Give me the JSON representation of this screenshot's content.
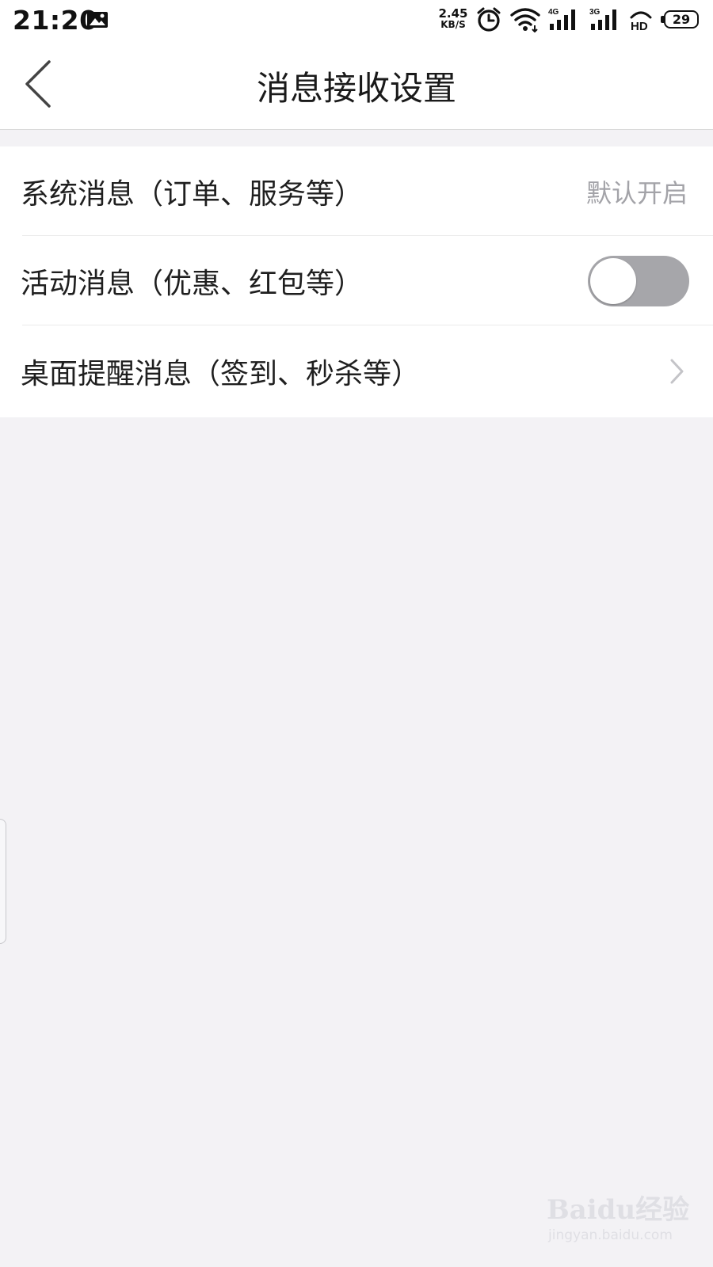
{
  "status_bar": {
    "time": "21:20",
    "network_speed_value": "2.45",
    "network_speed_unit": "KB/S",
    "signal_1_label": "4G",
    "signal_2_label": "3G",
    "hd_label": "HD",
    "battery_level": "29",
    "icons": [
      "notification-image-icon",
      "alarm-icon",
      "wifi-icon",
      "signal-4g-icon",
      "signal-3g-icon",
      "hd-icon",
      "battery-icon"
    ]
  },
  "nav": {
    "title": "消息接收设置",
    "back_icon": "chevron-left-icon"
  },
  "settings": {
    "items": [
      {
        "label": "系统消息（订单、服务等）",
        "value": "默认开启",
        "control": "text"
      },
      {
        "label": "活动消息（优惠、红包等）",
        "control": "toggle",
        "toggle_on": false
      },
      {
        "label": "桌面提醒消息（签到、秒杀等）",
        "control": "chevron",
        "icon": "chevron-right-icon"
      }
    ]
  },
  "watermark": {
    "brand": "Baidu经验",
    "url": "jingyan.baidu.com"
  },
  "colors": {
    "page_background": "#f3f2f5",
    "card_background": "#ffffff",
    "secondary_text": "#a3a3a8",
    "toggle_off": "#a6a6aa"
  }
}
